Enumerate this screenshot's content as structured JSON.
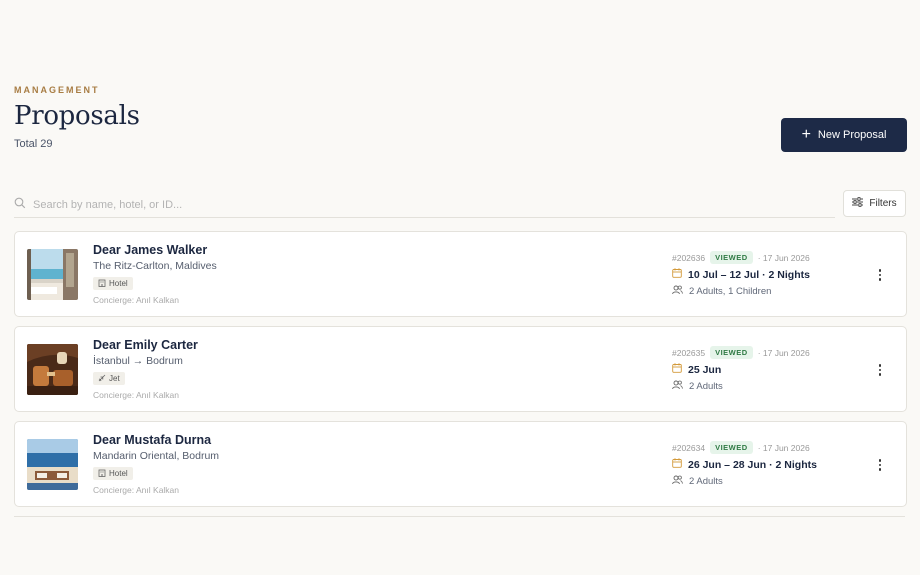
{
  "header": {
    "eyebrow": "MANAGEMENT",
    "title": "Proposals",
    "total": "Total 29",
    "new_button": "New Proposal"
  },
  "search": {
    "placeholder": "Search by name, hotel, or ID..."
  },
  "filters_label": "Filters",
  "proposals": [
    {
      "name": "Dear James Walker",
      "place": "The Ritz-Carlton, Maldives",
      "tag": "Hotel",
      "tag_icon": "building-icon",
      "concierge_label": "Concierge:",
      "concierge": "Anıl Kalkan",
      "id": "#202636",
      "status": "VIEWED",
      "date_sent": "· 17 Jun 2026",
      "dates": "10 Jul – 12 Jul · 2 Nights",
      "guests": "2 Adults, 1 Children"
    },
    {
      "name": "Dear Emily Carter",
      "place": "İstanbul → Bodrum",
      "tag": "Jet",
      "tag_icon": "plane-icon",
      "concierge_label": "Concierge:",
      "concierge": "Anıl Kalkan",
      "id": "#202635",
      "status": "VIEWED",
      "date_sent": "· 17 Jun 2026",
      "dates": "25 Jun",
      "guests": "2 Adults"
    },
    {
      "name": "Dear Mustafa Durna",
      "place": "Mandarin Oriental, Bodrum",
      "tag": "Hotel",
      "tag_icon": "building-icon",
      "concierge_label": "Concierge:",
      "concierge": "Anıl Kalkan",
      "id": "#202634",
      "status": "VIEWED",
      "date_sent": "· 17 Jun 2026",
      "dates": "26 Jun – 28 Jun · 2 Nights",
      "guests": "2 Adults"
    }
  ],
  "colors": {
    "accent": "#1d2a47",
    "eyebrow": "#a87d44",
    "badge_bg": "#e6f4ea",
    "badge_text": "#2f7a44",
    "calendar_icon": "#d39a3a"
  }
}
